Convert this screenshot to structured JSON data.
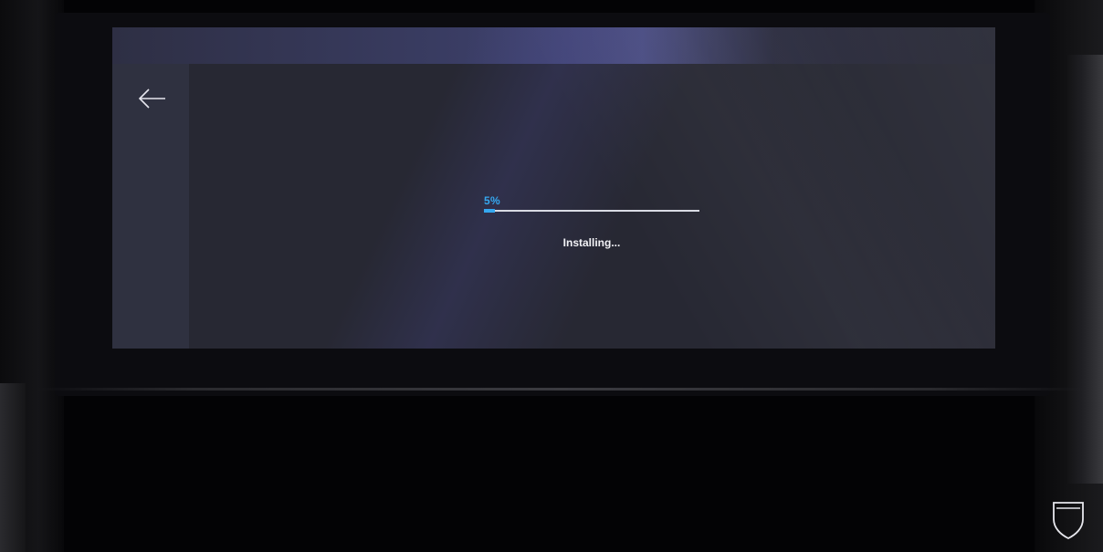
{
  "screen": {
    "back_icon": "arrow-left-icon",
    "progress": {
      "percent_label": "5%",
      "value": 0.05
    },
    "status_text": "Installing..."
  },
  "brand": {
    "crest_icon": "shield-crest-icon"
  },
  "colors": {
    "accent": "#35a8f0",
    "screen_bg": "#272833",
    "sidebar_bg": "#2f3140",
    "track": "#d9dbe4",
    "text": "#f2f2f6"
  }
}
